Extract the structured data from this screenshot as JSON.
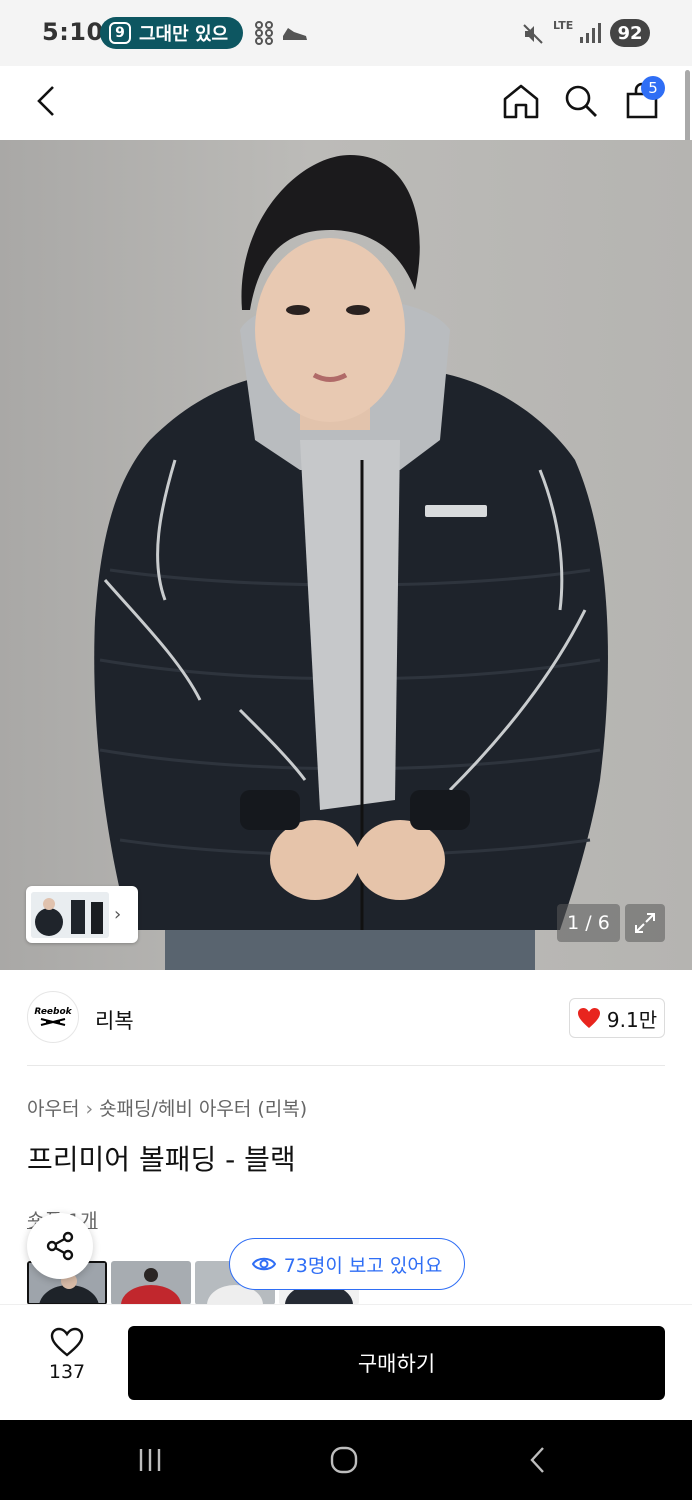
{
  "status_bar": {
    "time": "5:10",
    "notification_text": "그대만 있으",
    "notification_badge": "9",
    "lte_label": "LTE",
    "battery": "92"
  },
  "header": {
    "back_icon": "chevron-left-icon",
    "home_icon": "home-icon",
    "search_icon": "search-icon",
    "cart_icon": "shopping-bag-icon",
    "cart_count": "5"
  },
  "gallery": {
    "pager_text": "1 / 6",
    "expand_icon": "expand-icon"
  },
  "brand": {
    "logo_text": "Reebok",
    "name": "리복",
    "likes": "9.1만",
    "heart_color": "#e8251e"
  },
  "product": {
    "breadcrumb": [
      "아우터",
      "숏패딩/헤비 아우터 (리복)"
    ],
    "title": "프리미어 볼패딩 - 블랙",
    "partial_label": "숏폼 1개"
  },
  "floating": {
    "viewers_text": "73명이 보고 있어요",
    "accent": "#2f6ef5"
  },
  "bottom_bar": {
    "wish_count": "137",
    "buy_label": "구매하기"
  }
}
